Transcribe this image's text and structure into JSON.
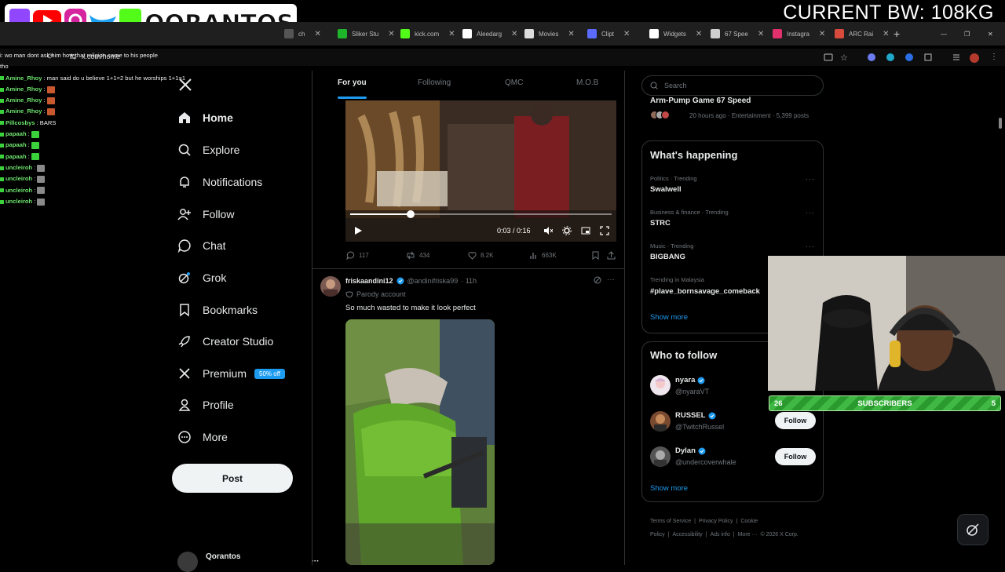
{
  "overlay": {
    "brand_name": "QORANTOS",
    "bw_text": "CURRENT BW: 108KG"
  },
  "browser": {
    "tabs": [
      {
        "label": "ch",
        "color": "#555555"
      },
      {
        "label": "Sliker Stu",
        "color": "#1fb52b"
      },
      {
        "label": "kick.com",
        "color": "#53fc18"
      },
      {
        "label": "Aleedarg",
        "color": "#ffffff"
      },
      {
        "label": "Movies",
        "color": "#dddddd"
      },
      {
        "label": "Clipt",
        "color": "#5b6bff"
      },
      {
        "label": "Widgets",
        "color": "#ffffff"
      },
      {
        "label": "67 Spee",
        "color": "#cfcfcf"
      },
      {
        "label": "Instagra",
        "color": "#e1306c"
      },
      {
        "label": "ARC Rai",
        "color": "#d84b3c"
      }
    ],
    "url": "x.com/home"
  },
  "chat": [
    {
      "user": "",
      "msg": "i: wo man dont ask him how that religion came to his people",
      "emote": ""
    },
    {
      "user": "",
      "msg": "tho",
      "emote": ""
    },
    {
      "user": "Amine_Rhoy",
      "msg": ": man said do u believe 1+1=2 but he worships 1+1=1",
      "emote": ""
    },
    {
      "user": "Amine_Rhoy",
      "msg": ":",
      "emote": "#c8582e"
    },
    {
      "user": "Amine_Rhoy",
      "msg": ":",
      "emote": "#c8582e"
    },
    {
      "user": "Amine_Rhoy",
      "msg": ":",
      "emote": "#c8582e"
    },
    {
      "user": "Pillcosbys",
      "msg": ": BARS",
      "emote": ""
    },
    {
      "user": "papaah",
      "msg": ":",
      "emote": "#3ad13a"
    },
    {
      "user": "papaah",
      "msg": ":",
      "emote": "#3ad13a"
    },
    {
      "user": "papaah",
      "msg": ":",
      "emote": "#3ad13a"
    },
    {
      "user": "uncleiroh",
      "msg": ":",
      "emote": "#8a8a8a"
    },
    {
      "user": "uncleiroh",
      "msg": ":",
      "emote": "#8a8a8a"
    },
    {
      "user": "uncleiroh",
      "msg": ":",
      "emote": "#8a8a8a"
    },
    {
      "user": "uncleiroh",
      "msg": ":",
      "emote": "#8a8a8a"
    }
  ],
  "nav": {
    "home": "Home",
    "explore": "Explore",
    "notifications": "Notifications",
    "follow": "Follow",
    "chat": "Chat",
    "grok": "Grok",
    "bookmarks": "Bookmarks",
    "creator_studio": "Creator Studio",
    "premium": "Premium",
    "premium_badge": "50% off",
    "profile": "Profile",
    "more": "More",
    "post": "Post",
    "account_name": "Qorantos"
  },
  "feed_tabs": [
    "For you",
    "Following",
    "QMC",
    "M.O.B"
  ],
  "video": {
    "time": "0:03 / 0:16",
    "progress": 0.23
  },
  "tweet1_actions": {
    "replies": "117",
    "reposts": "434",
    "likes": "8.2K",
    "views": "663K"
  },
  "tweet2": {
    "name": "friskaandini12",
    "handle": "@andinifriska99",
    "time": "· 11h",
    "parody": "Parody account",
    "text": "So much wasted to make it look perfect"
  },
  "right": {
    "search_placeholder": "Search",
    "trend_card_title": "Arm-Pump Game 67 Speed",
    "trend_card_meta": "20 hours ago · Entertainment · 5,399 posts",
    "happening_title": "What's happening",
    "trends": [
      {
        "category": "Politics · Trending",
        "name": "Swalwell"
      },
      {
        "category": "Business & finance · Trending",
        "name": "STRC"
      },
      {
        "category": "Music · Trending",
        "name": "BIGBANG"
      },
      {
        "category": "Trending in Malaysia",
        "name": "#plave_bornsavage_comeback"
      }
    ],
    "show_more": "Show more",
    "wtf_title": "Who to follow",
    "suggestions": [
      {
        "name": "nyara",
        "handle": "@nyaraVT",
        "button": ""
      },
      {
        "name": "RUSSEL",
        "handle": "@TwitchRussel",
        "button": "Follow"
      },
      {
        "name": "Dylan",
        "handle": "@undercoverwhale",
        "button": "Follow"
      }
    ],
    "footer": [
      "Terms of Service",
      "|",
      "Privacy Policy",
      "|",
      "Cookie Policy",
      "|",
      "Accessibility",
      "|",
      "Ads info",
      "|",
      "More ···",
      "© 2026 X Corp."
    ]
  },
  "subs": {
    "left": "26",
    "label": "SUBSCRIBERS",
    "right": "5"
  },
  "colors": {
    "accent": "#1d9bf0",
    "background": "#000000",
    "subs_green": "#2a9a2e"
  }
}
